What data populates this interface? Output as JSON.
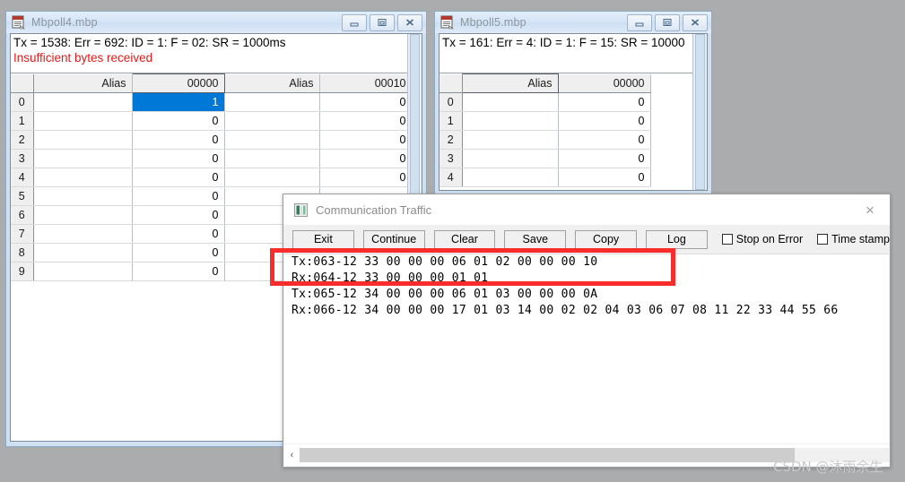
{
  "desktop": {
    "background_color": "#abacae",
    "watermark": "CSDN @沐雨余生"
  },
  "windows": [
    {
      "id": "mbpoll4",
      "title": "Mbpoll4.mbp",
      "icon": "document-window-icon",
      "status_line": "Tx = 1538: Err = 692: ID = 1: F = 02: SR = 1000ms",
      "error_line": "Insufficient bytes received",
      "buttons": {
        "minimize": "minimize-icon",
        "restore": "restore-icon",
        "close": "close-icon"
      },
      "grid": {
        "headers": [
          "",
          "Alias",
          "00000",
          "Alias",
          "00010"
        ],
        "selected_header_index": 2,
        "rows": [
          {
            "num": "0",
            "alias1": "",
            "value1": "1",
            "alias2": "",
            "value2": "0",
            "selected": true
          },
          {
            "num": "1",
            "alias1": "",
            "value1": "0",
            "alias2": "",
            "value2": "0",
            "selected": false
          },
          {
            "num": "2",
            "alias1": "",
            "value1": "0",
            "alias2": "",
            "value2": "0",
            "selected": false
          },
          {
            "num": "3",
            "alias1": "",
            "value1": "0",
            "alias2": "",
            "value2": "0",
            "selected": false
          },
          {
            "num": "4",
            "alias1": "",
            "value1": "0",
            "alias2": "",
            "value2": "0",
            "selected": false
          },
          {
            "num": "5",
            "alias1": "",
            "value1": "0",
            "alias2": "",
            "value2": "",
            "selected": false
          },
          {
            "num": "6",
            "alias1": "",
            "value1": "0",
            "alias2": "",
            "value2": "",
            "selected": false
          },
          {
            "num": "7",
            "alias1": "",
            "value1": "0",
            "alias2": "",
            "value2": "",
            "selected": false
          },
          {
            "num": "8",
            "alias1": "",
            "value1": "0",
            "alias2": "",
            "value2": "",
            "selected": false
          },
          {
            "num": "9",
            "alias1": "",
            "value1": "0",
            "alias2": "",
            "value2": "",
            "selected": false
          }
        ]
      }
    },
    {
      "id": "mbpoll5",
      "title": "Mbpoll5.mbp",
      "icon": "document-window-icon",
      "status_line": "Tx = 161: Err = 4: ID = 1: F = 15: SR = 10000",
      "buttons": {
        "minimize": "minimize-icon",
        "restore": "restore-icon",
        "close": "close-icon"
      },
      "grid": {
        "headers": [
          "",
          "Alias",
          "00000"
        ],
        "selected_header_index": 1,
        "rows": [
          {
            "num": "0",
            "alias1": "",
            "value1": "0"
          },
          {
            "num": "1",
            "alias1": "",
            "value1": "0"
          },
          {
            "num": "2",
            "alias1": "",
            "value1": "0"
          },
          {
            "num": "3",
            "alias1": "",
            "value1": "0"
          },
          {
            "num": "4",
            "alias1": "",
            "value1": "0"
          }
        ]
      }
    }
  ],
  "comm_dialog": {
    "title": "Communication Traffic",
    "icon": "traffic-window-icon",
    "close_label": "×",
    "toolbar": {
      "buttons": [
        {
          "name": "exit",
          "label": "Exit"
        },
        {
          "name": "continue",
          "label": "Continue"
        },
        {
          "name": "clear",
          "label": "Clear"
        },
        {
          "name": "save",
          "label": "Save"
        },
        {
          "name": "copy",
          "label": "Copy"
        },
        {
          "name": "log",
          "label": "Log"
        }
      ],
      "checkboxes": [
        {
          "name": "stop-on-error",
          "label": "Stop on Error",
          "checked": false
        },
        {
          "name": "time-stamp",
          "label": "Time stamp",
          "checked": false
        }
      ]
    },
    "log_lines": [
      "Tx:063-12 33 00 00 00 06 01 02 00 00 00 10",
      "Rx:064-12 33 00 00 00 01 01",
      "Tx:065-12 34 00 00 00 06 01 03 00 00 00 0A",
      "Rx:066-12 34 00 00 00 17 01 03 14 00 02 02 04 03 06 07 08 11 22 33 44 55 66"
    ],
    "scrollbar": {
      "left_arrow": "‹"
    }
  },
  "annotation": {
    "type": "red-rectangle",
    "color": "#fb2c2c",
    "covers_log_lines": [
      0,
      1
    ]
  }
}
